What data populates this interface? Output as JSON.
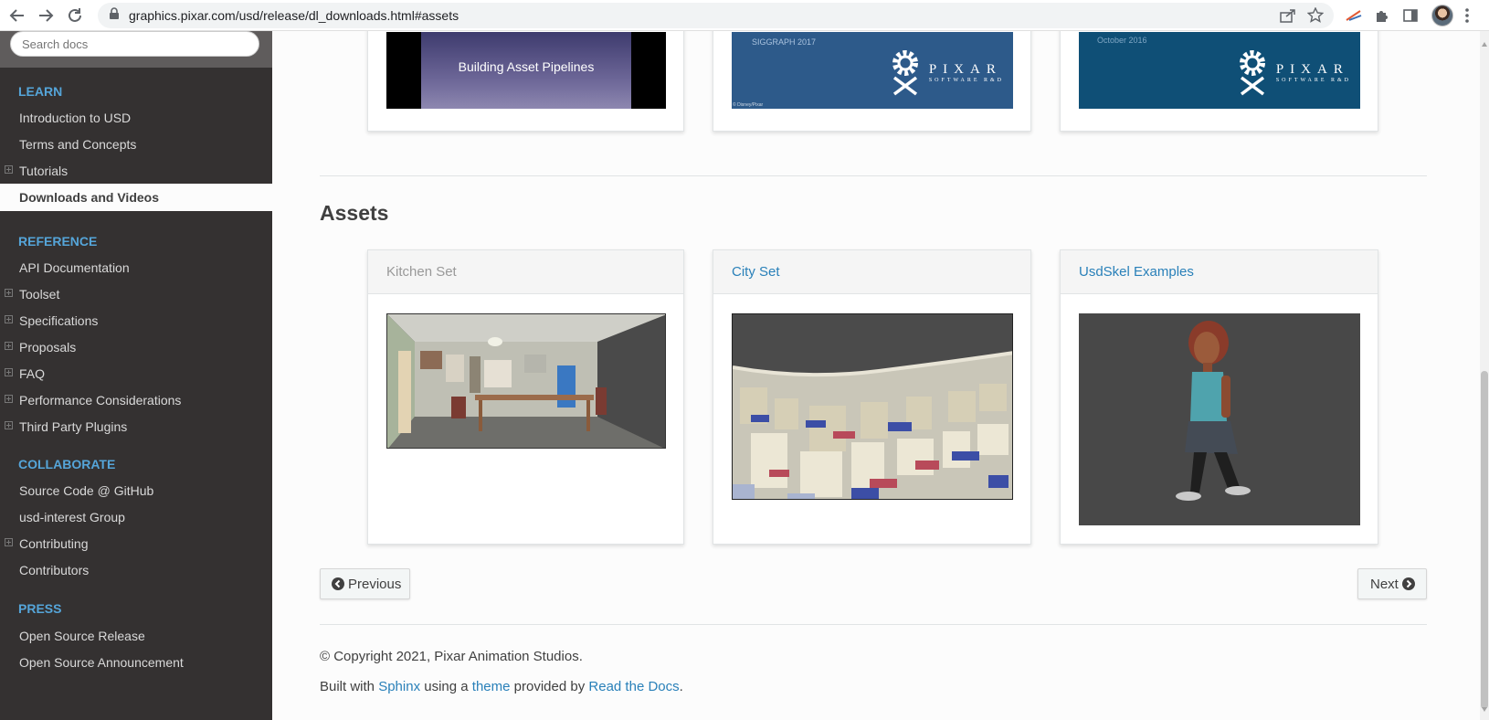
{
  "browser": {
    "url": "graphics.pixar.com/usd/release/dl_downloads.html#assets"
  },
  "sidebar": {
    "search_placeholder": "Search docs",
    "sections": {
      "learn": "LEARN",
      "reference": "REFERENCE",
      "collaborate": "COLLABORATE",
      "press": "PRESS"
    },
    "learn_items": [
      "Introduction to USD",
      "Terms and Concepts",
      "Tutorials",
      "Downloads and Videos"
    ],
    "reference_items": [
      "API Documentation",
      "Toolset",
      "Specifications",
      "Proposals",
      "FAQ",
      "Performance Considerations",
      "Third Party Plugins"
    ],
    "collaborate_items": [
      "Source Code @ GitHub",
      "usd-interest Group",
      "Contributing",
      "Contributors"
    ],
    "press_items": [
      "Open Source Release",
      "Open Source Announcement"
    ]
  },
  "videos": {
    "card1_caption": "Building Asset Pipelines",
    "card2_caption": "SIGGRAPH 2017",
    "card2_credit": "© Disney/Pixar",
    "card3_caption": "October 2016",
    "pixar_word": "PIXAR",
    "pixar_sub": "SOFTWARE R&D"
  },
  "assets": {
    "heading": "Assets",
    "cards": [
      "Kitchen Set",
      "City Set",
      "UsdSkel Examples"
    ]
  },
  "pager": {
    "previous": "Previous",
    "next": "Next"
  },
  "footer": {
    "copyright": "© Copyright 2021, Pixar Animation Studios.",
    "built_with": "Built with",
    "sphinx": "Sphinx",
    "using_a": "using a",
    "theme": "theme",
    "provided_by": "provided by",
    "rtd": "Read the Docs",
    "period": "."
  },
  "colors": {
    "sidebar_bg": "#343131",
    "caption": "#55a5d9",
    "link": "#2980b9"
  }
}
